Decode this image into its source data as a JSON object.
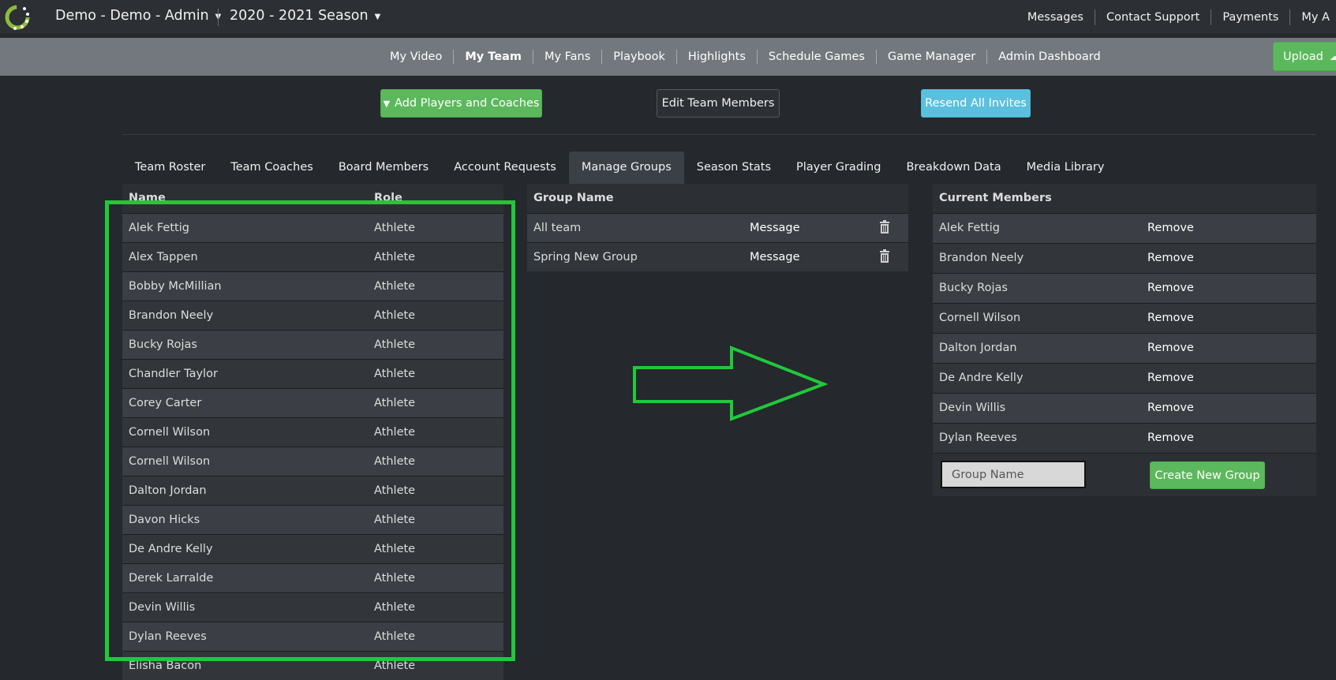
{
  "header": {
    "team_label": "Demo - Demo - Admin",
    "season_label": "2020 - 2021 Season",
    "links": [
      "Messages",
      "Contact Support",
      "Payments",
      "My A"
    ]
  },
  "nav": {
    "links": [
      "My Video",
      "My Team",
      "My Fans",
      "Playbook",
      "Highlights",
      "Schedule Games",
      "Game Manager",
      "Admin Dashboard"
    ],
    "active": "My Team",
    "upload_label": "Upload"
  },
  "actions": {
    "add_players": "Add Players and Coaches",
    "edit_members": "Edit Team Members",
    "resend_invites": "Resend All Invites"
  },
  "tabs": [
    "Team Roster",
    "Team Coaches",
    "Board Members",
    "Account Requests",
    "Manage Groups",
    "Season Stats",
    "Player Grading",
    "Breakdown Data",
    "Media Library"
  ],
  "active_tab": "Manage Groups",
  "roster": {
    "col_name": "Name",
    "col_role": "Role",
    "rows": [
      {
        "name": "Alek Fettig",
        "role": "Athlete"
      },
      {
        "name": "Alex Tappen",
        "role": "Athlete"
      },
      {
        "name": "Bobby McMillian",
        "role": "Athlete"
      },
      {
        "name": "Brandon Neely",
        "role": "Athlete"
      },
      {
        "name": "Bucky Rojas",
        "role": "Athlete"
      },
      {
        "name": "Chandler Taylor",
        "role": "Athlete"
      },
      {
        "name": "Corey Carter",
        "role": "Athlete"
      },
      {
        "name": "Cornell Wilson",
        "role": "Athlete"
      },
      {
        "name": "Cornell Wilson",
        "role": "Athlete"
      },
      {
        "name": "Dalton Jordan",
        "role": "Athlete"
      },
      {
        "name": "Davon Hicks",
        "role": "Athlete"
      },
      {
        "name": "De Andre Kelly",
        "role": "Athlete"
      },
      {
        "name": "Derek Larralde",
        "role": "Athlete"
      },
      {
        "name": "Devin Willis",
        "role": "Athlete"
      },
      {
        "name": "Dylan Reeves",
        "role": "Athlete"
      },
      {
        "name": "Elisha Bacon",
        "role": "Athlete"
      }
    ]
  },
  "groups": {
    "header": "Group Name",
    "rows": [
      {
        "name": "All team",
        "action": "Message"
      },
      {
        "name": "Spring New Group",
        "action": "Message"
      }
    ]
  },
  "members": {
    "header": "Current Members",
    "remove_label": "Remove",
    "rows": [
      "Alek Fettig",
      "Brandon Neely",
      "Bucky Rojas",
      "Cornell Wilson",
      "Dalton Jordan",
      "De Andre Kelly",
      "Devin Willis",
      "Dylan Reeves"
    ],
    "group_name_placeholder": "Group Name",
    "create_label": "Create New Group"
  },
  "colors": {
    "highlight": "#1fc93a",
    "green_button": "#5cb85c",
    "blue_button": "#5bc0de"
  }
}
